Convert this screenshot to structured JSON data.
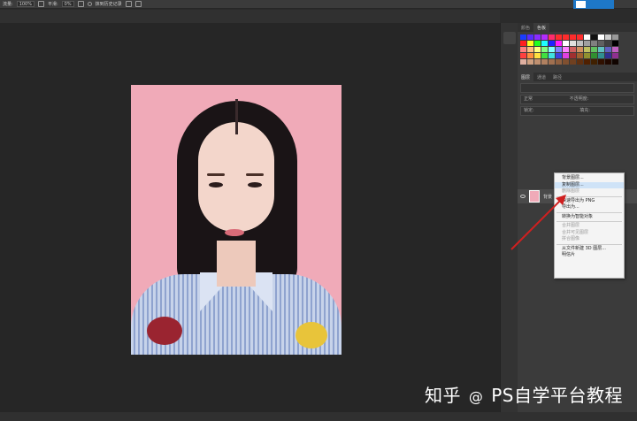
{
  "options_bar": {
    "flow_label": "流量:",
    "flow_value": "100%",
    "smooth_label": "平滑:",
    "smooth_value": "0%",
    "erase_history_label": "抹到历史记录"
  },
  "layers_panel": {
    "tabs": [
      "图层",
      "通道",
      "路径"
    ],
    "mode_value": "正常",
    "opacity_label": "不透明度:",
    "lock_label": "锁定:",
    "fill_label": "填充:",
    "layer_name": "背景"
  },
  "swatch_panel": {
    "tabs": [
      "颜色",
      "色板"
    ]
  },
  "context_menu": {
    "items": [
      {
        "label": "背景图层...",
        "disabled": false
      },
      {
        "label": "复制图层...",
        "disabled": false,
        "highlighted": true
      },
      {
        "label": "删除图层",
        "disabled": true
      },
      {
        "label": "快速导出为 PNG",
        "disabled": false
      },
      {
        "label": "导出为...",
        "disabled": false
      },
      {
        "label": "转换为智能对象",
        "disabled": false
      },
      {
        "label": "合并图层",
        "disabled": true
      },
      {
        "label": "合并可见图层",
        "disabled": true
      },
      {
        "label": "拼合图像",
        "disabled": true
      },
      {
        "label": "从文件新建 3D 图层...",
        "disabled": false
      },
      {
        "label": "明信片",
        "disabled": false
      }
    ]
  },
  "watermark": {
    "text": "知乎",
    "handle": "PS自学平台教程"
  },
  "colors": {
    "accent_blue": "#1e78c8",
    "arrow_red": "#d02020",
    "photo_bg": "#f0aab8"
  },
  "swatch_colors": [
    "#1a3cff",
    "#5a2cff",
    "#8a2cff",
    "#b22cff",
    "#ff2c6c",
    "#ff2c2c",
    "#ff2c2c",
    "#ff2c2c",
    "#ff2c2c",
    "#ffffff",
    "#111111",
    "#ffffff",
    "#cccccc",
    "#999999",
    "#ff2020",
    "#ffff20",
    "#20ff20",
    "#20ffff",
    "#2020ff",
    "#ff20ff",
    "#ffffff",
    "#e0e0e0",
    "#c0c0c0",
    "#a0a0a0",
    "#808080",
    "#606060",
    "#404040",
    "#000000",
    "#ff8080",
    "#ffc080",
    "#ffff80",
    "#80ff80",
    "#80ffff",
    "#8080ff",
    "#ff80ff",
    "#d06060",
    "#d09060",
    "#c0c060",
    "#60c060",
    "#60c0c0",
    "#6060c0",
    "#c060c0",
    "#ff4040",
    "#ff9040",
    "#ffe040",
    "#40e040",
    "#40e0e0",
    "#4040e0",
    "#e040e0",
    "#a03030",
    "#a06030",
    "#909030",
    "#309030",
    "#309090",
    "#303090",
    "#903090",
    "#e0b0a0",
    "#d0a080",
    "#c09070",
    "#b08060",
    "#a07050",
    "#906040",
    "#805030",
    "#704020",
    "#603010",
    "#502000",
    "#402000",
    "#301000",
    "#200800",
    "#100400"
  ]
}
